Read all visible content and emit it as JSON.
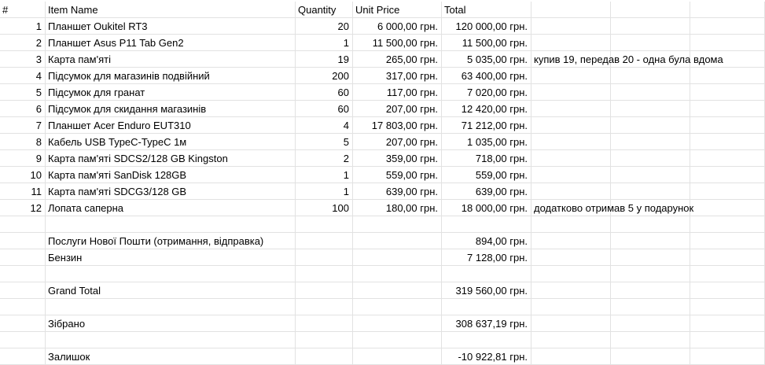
{
  "headers": [
    "#",
    "Item Name",
    "Quantity",
    "Unit Price",
    "Total"
  ],
  "items": [
    {
      "n": "1",
      "name": "Планшет Oukitel RT3",
      "qty": "20",
      "price": "6 000,00 грн.",
      "total": "120 000,00 грн.",
      "note": ""
    },
    {
      "n": "2",
      "name": "Планшет Asus P11 Tab Gen2",
      "qty": "1",
      "price": "11 500,00 грн.",
      "total": "11 500,00 грн.",
      "note": ""
    },
    {
      "n": "3",
      "name": "Карта пам'яті",
      "qty": "19",
      "price": "265,00 грн.",
      "total": "5 035,00 грн.",
      "note": "купив 19, передав 20 - одна була вдома"
    },
    {
      "n": "4",
      "name": "Підсумок для магазинів подвійний",
      "qty": "200",
      "price": "317,00 грн.",
      "total": "63 400,00 грн.",
      "note": ""
    },
    {
      "n": "5",
      "name": "Підсумок для гранат",
      "qty": "60",
      "price": "117,00 грн.",
      "total": "7 020,00 грн.",
      "note": ""
    },
    {
      "n": "6",
      "name": "Підсумок для скидання магазинів",
      "qty": "60",
      "price": "207,00 грн.",
      "total": "12 420,00 грн.",
      "note": ""
    },
    {
      "n": "7",
      "name": "Планшет Acer Enduro EUT310",
      "qty": "4",
      "price": "17 803,00 грн.",
      "total": "71 212,00 грн.",
      "note": ""
    },
    {
      "n": "8",
      "name": "Кабель USB TypeC-TypeC 1м",
      "qty": "5",
      "price": "207,00 грн.",
      "total": "1 035,00 грн.",
      "note": ""
    },
    {
      "n": "9",
      "name": "Карта пам'яті SDCS2/128 GB Kingston",
      "qty": "2",
      "price": "359,00 грн.",
      "total": "718,00 грн.",
      "note": ""
    },
    {
      "n": "10",
      "name": "Карта пам'яті SanDisk 128GB",
      "qty": "1",
      "price": "559,00 грн.",
      "total": "559,00 грн.",
      "note": ""
    },
    {
      "n": "11",
      "name": "Карта пам'яті SDCG3/128 GB",
      "qty": "1",
      "price": "639,00 грн.",
      "total": "639,00 грн.",
      "note": ""
    },
    {
      "n": "12",
      "name": "Лопата саперна",
      "qty": "100",
      "price": "180,00 грн.",
      "total": "18 000,00 грн.",
      "note": "додатково отримав 5 у подарунок"
    }
  ],
  "extras": [
    {
      "label": "",
      "total": ""
    },
    {
      "label": "Послуги Нової Пошти (отримання, відправка)",
      "total": "894,00 грн."
    },
    {
      "label": "Бензин",
      "total": "7 128,00 грн."
    },
    {
      "label": "",
      "total": ""
    },
    {
      "label": "Grand Total",
      "total": "319 560,00 грн."
    },
    {
      "label": "",
      "total": ""
    },
    {
      "label": "Зібрано",
      "total": "308 637,19 грн."
    },
    {
      "label": "",
      "total": ""
    },
    {
      "label": "Залишок",
      "total": "-10 922,81 грн."
    }
  ]
}
